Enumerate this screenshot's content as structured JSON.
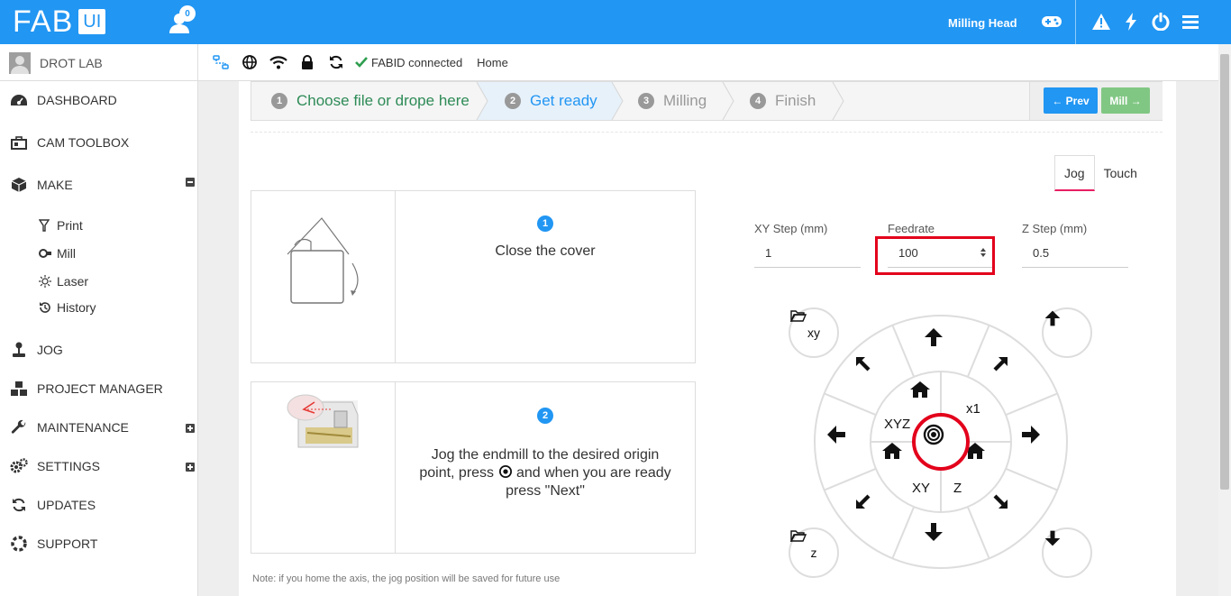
{
  "topbar": {
    "logo_main": "FAB",
    "logo_sub": "UI",
    "notifications_count": "0",
    "head_label": "Milling Head",
    "icons": [
      "gamepad-icon",
      "warning-icon",
      "bolt-icon",
      "power-icon",
      "menu-icon"
    ]
  },
  "profile": {
    "name": "DROT LAB"
  },
  "status": {
    "icons": [
      "network-icon",
      "globe-icon",
      "wifi-icon",
      "lock-icon",
      "sync-icon"
    ],
    "fabid": "FABID connected",
    "breadcrumb": "Home"
  },
  "sidebar": {
    "items": [
      {
        "label": "DASHBOARD",
        "icon": "dashboard-icon"
      },
      {
        "label": "CAM TOOLBOX",
        "icon": "toolbox-icon"
      },
      {
        "label": "MAKE",
        "icon": "cube-icon",
        "expanded": true
      },
      {
        "label": "JOG",
        "icon": "joystick-icon"
      },
      {
        "label": "PROJECT MANAGER",
        "icon": "cubes-icon"
      },
      {
        "label": "MAINTENANCE",
        "icon": "wrench-icon",
        "expandable": true
      },
      {
        "label": "SETTINGS",
        "icon": "gears-icon",
        "expandable": true
      },
      {
        "label": "UPDATES",
        "icon": "refresh-icon"
      },
      {
        "label": "SUPPORT",
        "icon": "lifebuoy-icon"
      }
    ],
    "make_sub": [
      {
        "label": "Print",
        "icon": "print-icon"
      },
      {
        "label": "Mill",
        "icon": "mill-icon"
      },
      {
        "label": "Laser",
        "icon": "laser-icon"
      },
      {
        "label": "History",
        "icon": "history-icon"
      }
    ]
  },
  "wizard": {
    "steps": [
      {
        "num": "1",
        "label": "Choose file or drope here",
        "state": "done"
      },
      {
        "num": "2",
        "label": "Get ready",
        "state": "active"
      },
      {
        "num": "3",
        "label": "Milling",
        "state": "pending"
      },
      {
        "num": "4",
        "label": "Finish",
        "state": "pending"
      }
    ],
    "prev_label": "Prev",
    "next_label": "Mill"
  },
  "instructions": [
    {
      "num": "1",
      "text": "Close the cover"
    },
    {
      "num": "2",
      "text_a": "Jog the endmill to the desired origin",
      "text_b": "point, press",
      "text_c": "and when you are ready",
      "text_d": "press \"Next\""
    }
  ],
  "note": "Note: if you home the axis, the jog position will be saved for future use",
  "jog_panel": {
    "tabs": [
      "Jog",
      "Touch"
    ],
    "active_tab": "Jog",
    "xy_step": {
      "label": "XY Step (mm)",
      "value": "1"
    },
    "feedrate": {
      "label": "Feedrate",
      "value": "100"
    },
    "z_step": {
      "label": "Z Step (mm)",
      "value": "0.5"
    },
    "labels": {
      "xyz": "XYZ",
      "x1": "x1",
      "xy": "XY",
      "z": "Z"
    },
    "corner_xy": "xy",
    "corner_z": "z",
    "highlight_color": "#e3001b"
  },
  "colors": {
    "primary": "#2196f3",
    "success": "#81c784",
    "highlight": "#e3001b"
  }
}
